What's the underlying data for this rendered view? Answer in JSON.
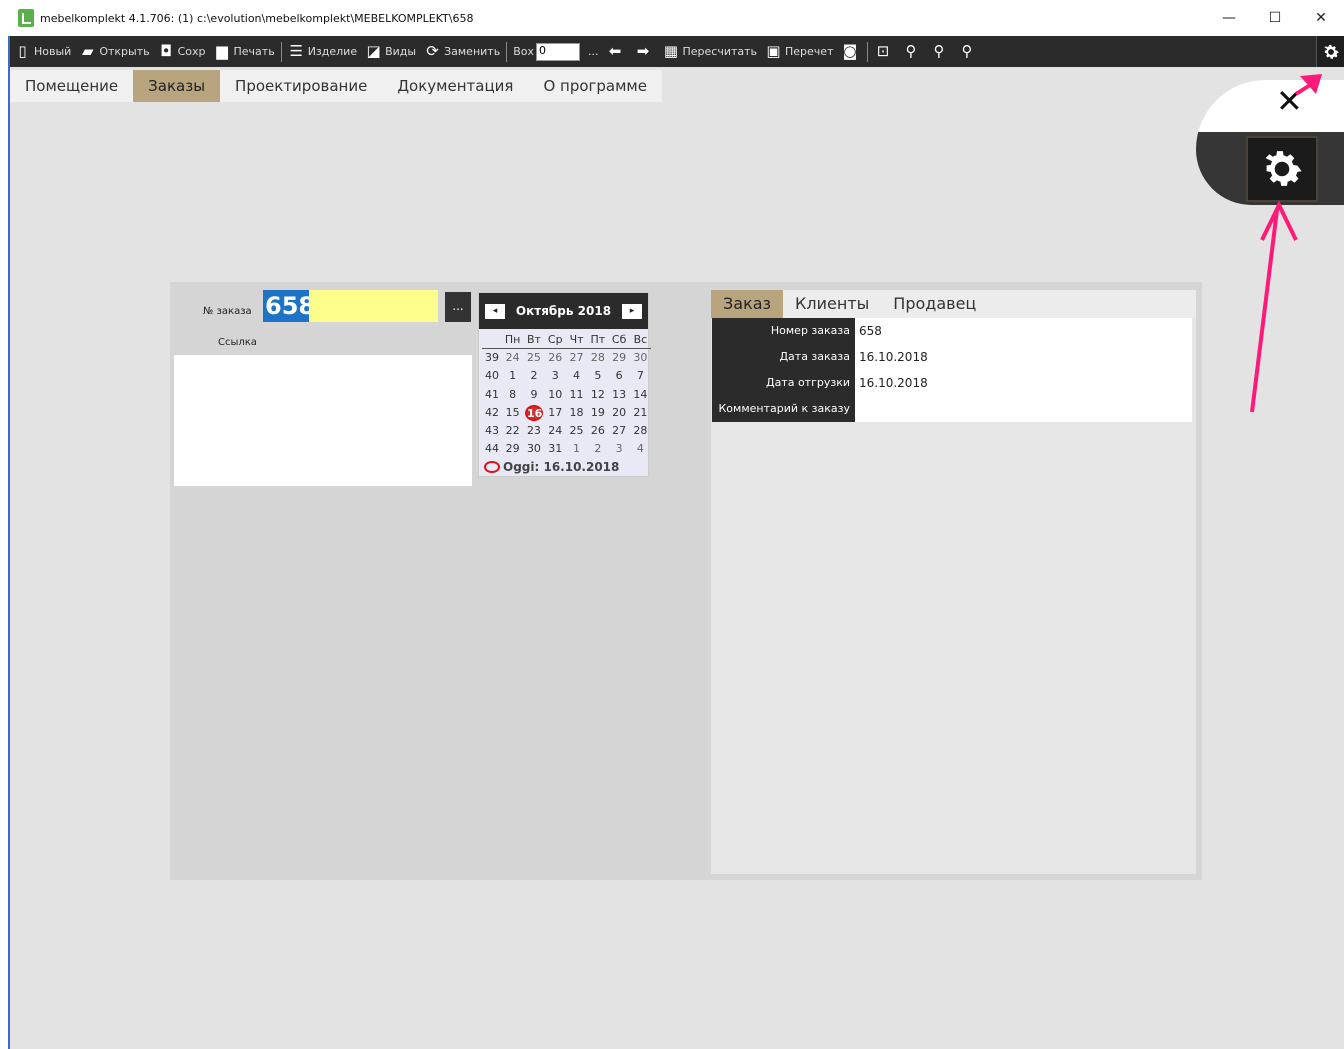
{
  "window": {
    "title": "mebelkomplekt 4.1.706: (1)  c:\\evolution\\mebelkomplekt\\MEBELKOMPLEKT\\658",
    "minimize": "—",
    "maximize": "☐",
    "close": "✕"
  },
  "toolbar": {
    "new_label": "Новый",
    "open_label": "Открыть",
    "save_label": "Сохр",
    "print_label": "Печать",
    "product_label": "Изделие",
    "views_label": "Виды",
    "replace_label": "Заменить",
    "box_label": "Вох",
    "box_value": "0",
    "dots_label": "...",
    "recalc_label": "Пересчитать",
    "recount_label": "Перечет"
  },
  "menu": {
    "items": [
      "Помещение",
      "Заказы",
      "Проектирование",
      "Документация",
      "О программе"
    ],
    "active": "Заказы"
  },
  "order": {
    "number_label": "№ заказа",
    "number_value": "658",
    "dots": "...",
    "link_label": "Ссылка"
  },
  "calendar": {
    "month_title": "Октябрь 2018",
    "prev": "◂",
    "next": "▸",
    "weekdays": [
      "Пн",
      "Вт",
      "Ср",
      "Чт",
      "Пт",
      "Сб",
      "Вс"
    ],
    "weeks": [
      {
        "week": "39",
        "days": [
          "24",
          "25",
          "26",
          "27",
          "28",
          "29",
          "30"
        ]
      },
      {
        "week": "40",
        "days": [
          "1",
          "2",
          "3",
          "4",
          "5",
          "6",
          "7"
        ]
      },
      {
        "week": "41",
        "days": [
          "8",
          "9",
          "10",
          "11",
          "12",
          "13",
          "14"
        ]
      },
      {
        "week": "42",
        "days": [
          "15",
          "16",
          "17",
          "18",
          "19",
          "20",
          "21"
        ]
      },
      {
        "week": "43",
        "days": [
          "22",
          "23",
          "24",
          "25",
          "26",
          "27",
          "28"
        ]
      },
      {
        "week": "44",
        "days": [
          "29",
          "30",
          "31",
          "1",
          "2",
          "3",
          "4"
        ]
      }
    ],
    "selected_day": "16",
    "today_label": "Oggi: 16.10.2018"
  },
  "tabs": {
    "items": [
      "Заказ",
      "Клиенты",
      "Продавец"
    ],
    "active": "Заказ"
  },
  "properties": [
    {
      "label": "Номер заказа",
      "value": "658"
    },
    {
      "label": "Дата заказа",
      "value": "16.10.2018"
    },
    {
      "label": "Дата отгрузки",
      "value": "16.10.2018"
    },
    {
      "label": "Комментарий к заказу",
      "value": ""
    }
  ],
  "colors": {
    "accent": "#b8a47f",
    "toolbar": "#2b2b2b",
    "order_number_bg": "#1e73c6",
    "order_input_bg": "#fdfd8c",
    "annotation_arrow": "#ff1a7a"
  }
}
